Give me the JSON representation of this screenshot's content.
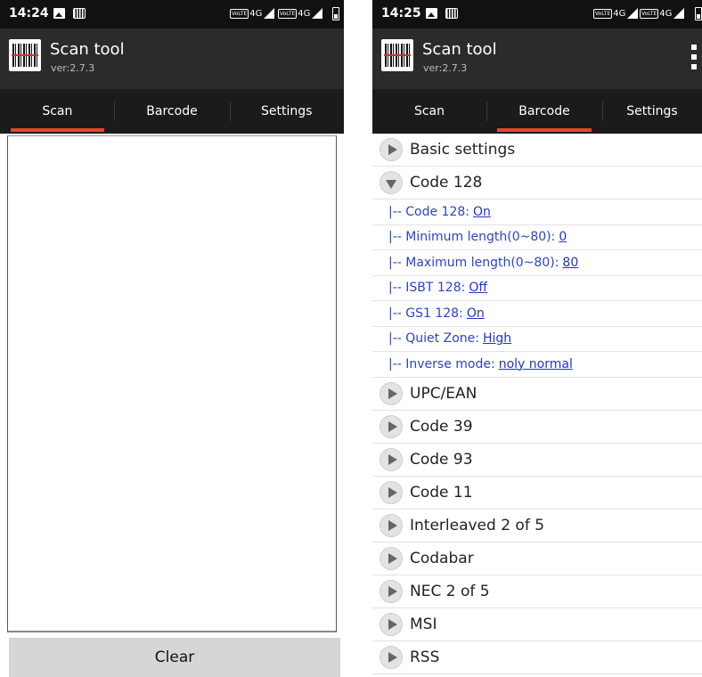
{
  "left_screen": {
    "status": {
      "time": "14:24",
      "network": "4G",
      "volte": "VoLTE"
    },
    "app": {
      "title": "Scan tool",
      "version": "ver:2.7.3"
    },
    "tabs": [
      "Scan",
      "Barcode",
      "Settings"
    ],
    "active_tab": "Scan",
    "clear_label": "Clear"
  },
  "right_screen": {
    "status": {
      "time": "14:25",
      "network": "4G",
      "volte": "VoLTE"
    },
    "app": {
      "title": "Scan tool",
      "version": "ver:2.7.3"
    },
    "tabs": [
      "Scan",
      "Barcode",
      "Settings"
    ],
    "active_tab": "Barcode",
    "sections": {
      "basic": "Basic settings",
      "code128": "Code 128",
      "others": [
        "UPC/EAN",
        "Code 39",
        "Code 93",
        "Code 11",
        "Interleaved 2 of 5",
        "Codabar",
        "NEC 2 of 5",
        "MSI",
        "RSS"
      ]
    },
    "code128_options": [
      {
        "label": "|-- Code 128:",
        "value": "On"
      },
      {
        "label": "|-- Minimum length(0~80):",
        "value": "0"
      },
      {
        "label": "|-- Maximum length(0~80):",
        "value": "80"
      },
      {
        "label": "|-- ISBT 128:",
        "value": "Off"
      },
      {
        "label": "|-- GS1 128:",
        "value": "On"
      },
      {
        "label": "|-- Quiet Zone:",
        "value": "High"
      },
      {
        "label": "|-- Inverse mode:",
        "value": "noly normal"
      }
    ]
  },
  "colors": {
    "tab_indicator": "#e8452e",
    "option_text": "#2a44c8",
    "appbar": "#2b2b2b"
  }
}
